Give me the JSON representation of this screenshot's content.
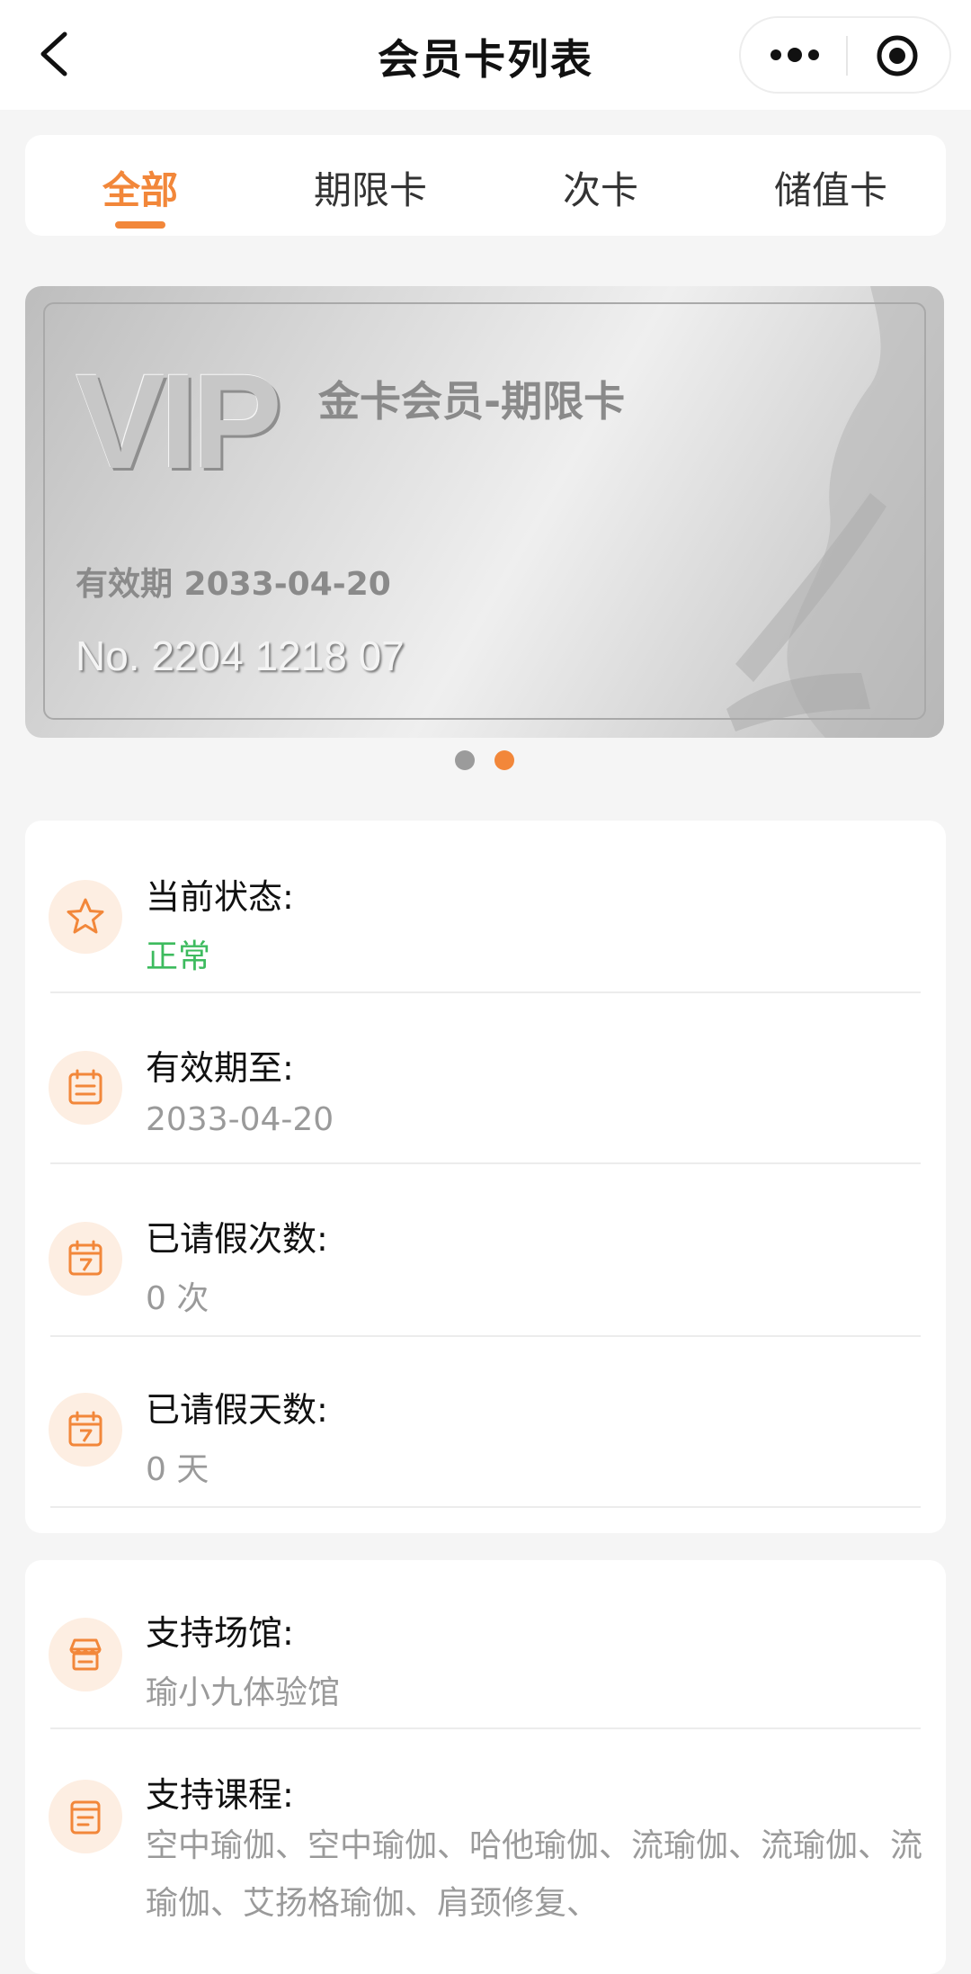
{
  "nav": {
    "title": "会员卡列表"
  },
  "tabs": [
    {
      "label": "全部",
      "active": true
    },
    {
      "label": "期限卡",
      "active": false
    },
    {
      "label": "次卡",
      "active": false
    },
    {
      "label": "储值卡",
      "active": false
    }
  ],
  "card": {
    "badge": "VIP",
    "name": "金卡会员-期限卡",
    "validity": "有效期 2033-04-20",
    "number": "No.  2204 1218 07"
  },
  "carousel": {
    "count": 2,
    "active_index": 1
  },
  "info": {
    "status_label": "当前状态:",
    "status_value": "正常",
    "expiry_label": "有效期至:",
    "expiry_value": "2033-04-20",
    "leave_times_label": "已请假次数:",
    "leave_times_value": "0 次",
    "leave_days_label": "已请假天数:",
    "leave_days_value": "0 天"
  },
  "support": {
    "venue_label": "支持场馆:",
    "venue_value": "瑜小九体验馆",
    "course_label": "支持课程:",
    "course_value": "空中瑜伽、空中瑜伽、哈他瑜伽、流瑜伽、流瑜伽、流瑜伽、艾扬格瑜伽、肩颈修复、"
  },
  "colors": {
    "accent": "#f2873a",
    "status_ok": "#3dbb5e",
    "icon_bg": "#fdeee2"
  }
}
